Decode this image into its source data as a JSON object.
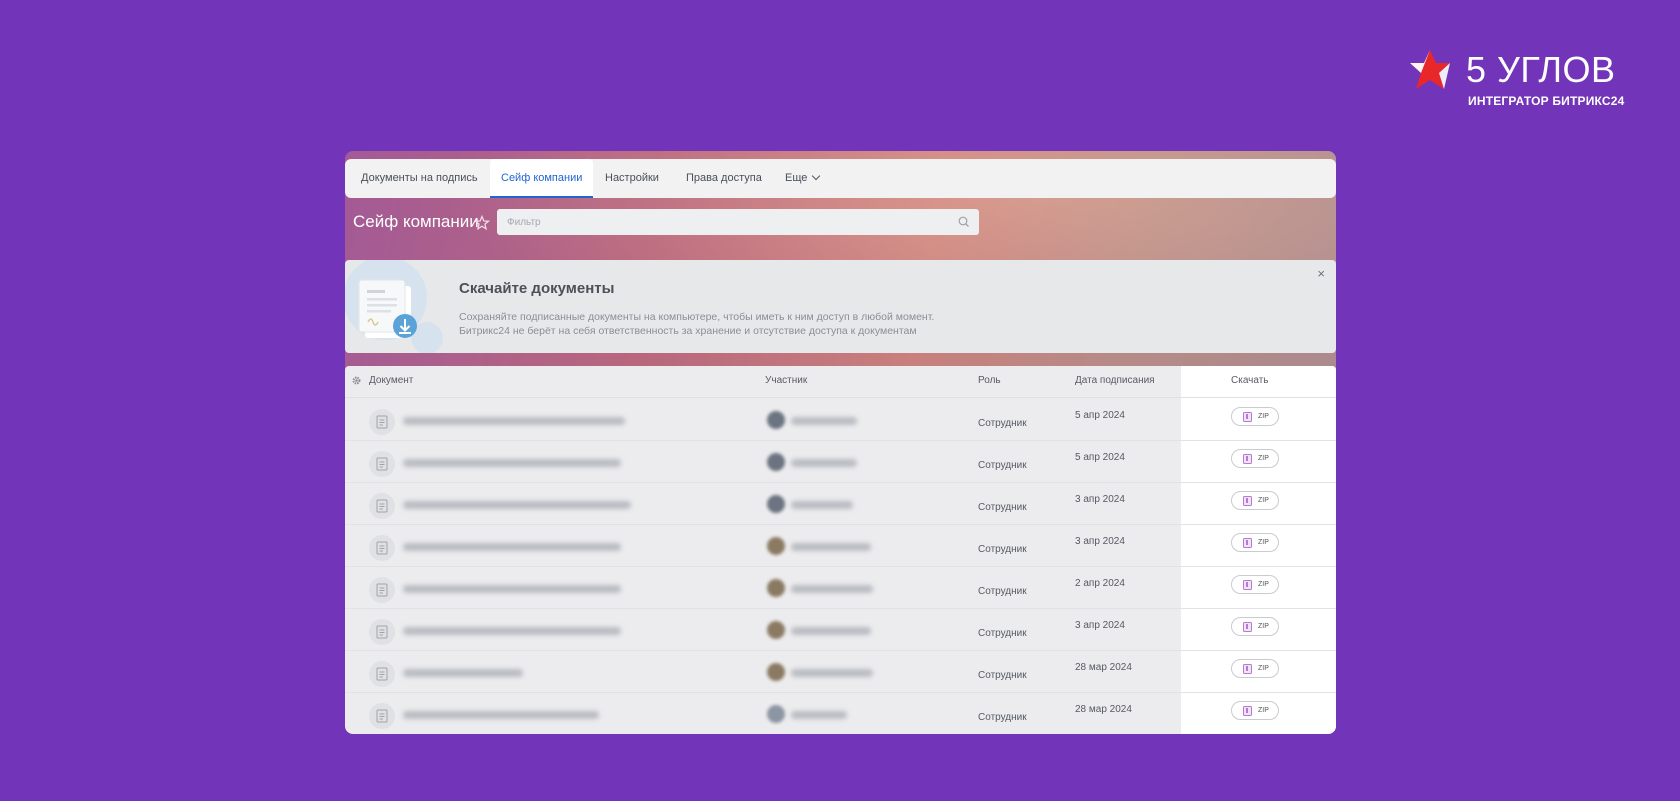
{
  "brand": {
    "name": "5 УГЛОВ",
    "tagline": "ИНТЕГРАТОР БИТРИКС24",
    "color": "#e8272b"
  },
  "tabs": [
    {
      "label": "Документы на подпись"
    },
    {
      "label": "Сейф компании",
      "active": true
    },
    {
      "label": "Настройки"
    },
    {
      "label": "Права доступа"
    },
    {
      "label": "Еще"
    }
  ],
  "page": {
    "title": "Сейф компании",
    "filter_placeholder": "Фильтр"
  },
  "banner": {
    "title": "Скачайте документы",
    "line1": "Сохраняйте подписанные документы на компьютере, чтобы иметь к ним доступ в любой момент.",
    "line2": "Битрикс24 не берёт на себя ответственность за хранение и отсутствие доступа к документам",
    "close": "×"
  },
  "table": {
    "columns": {
      "document": "Документ",
      "participant": "Участник",
      "role": "Роль",
      "date": "Дата подписания",
      "download": "Скачать"
    },
    "rows": [
      {
        "role": "Сотрудник",
        "date": "5 апр 2024",
        "download": "ZIP"
      },
      {
        "role": "Сотрудник",
        "date": "5 апр 2024",
        "download": "ZIP"
      },
      {
        "role": "Сотрудник",
        "date": "3 апр 2024",
        "download": "ZIP"
      },
      {
        "role": "Сотрудник",
        "date": "3 апр 2024",
        "download": "ZIP"
      },
      {
        "role": "Сотрудник",
        "date": "2 апр 2024",
        "download": "ZIP"
      },
      {
        "role": "Сотрудник",
        "date": "3 апр 2024",
        "download": "ZIP"
      },
      {
        "role": "Сотрудник",
        "date": "28 мар 2024",
        "download": "ZIP"
      },
      {
        "role": "Сотрудник",
        "date": "28 мар 2024",
        "download": "ZIP"
      }
    ]
  }
}
